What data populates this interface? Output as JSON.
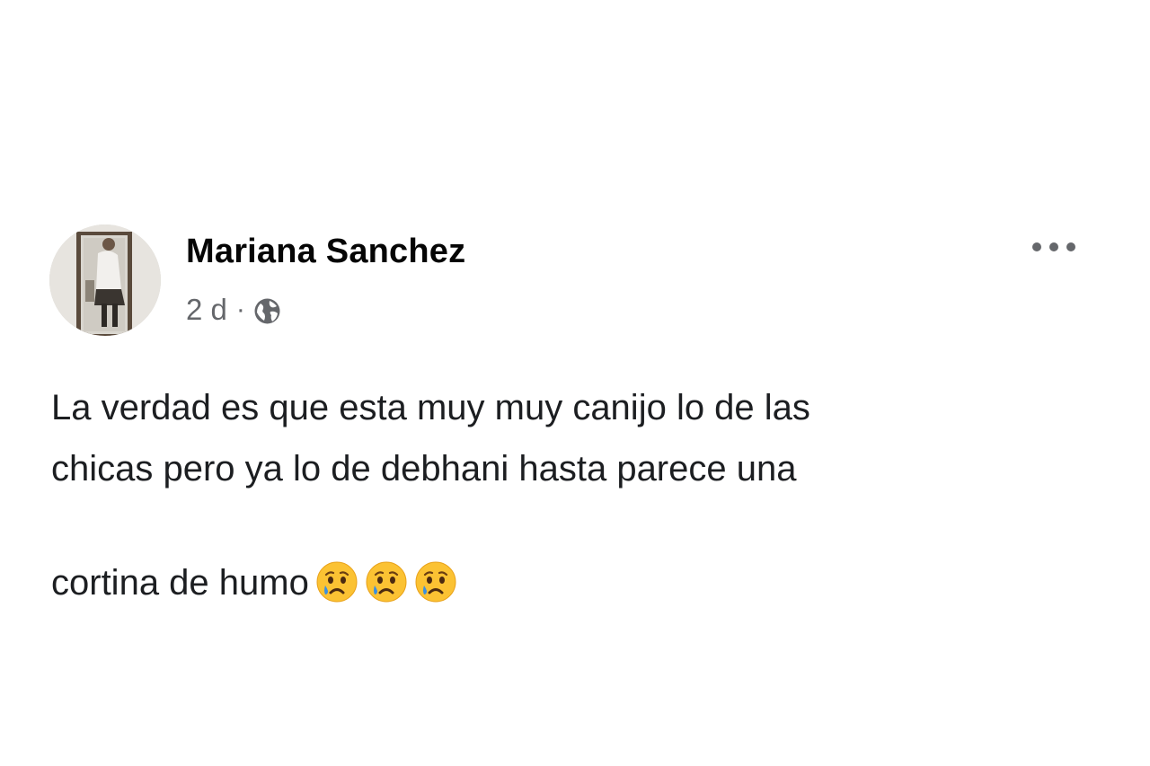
{
  "post": {
    "author": "Mariana Sanchez",
    "timestamp": "2 d",
    "separator": "·",
    "audience_icon": "globe-icon",
    "menu_icon": "more-options-icon",
    "body_text": "La verdad es que esta muy muy canijo lo de las\nchicas pero ya lo de debhani hasta parece una\ncortina de humo",
    "emojis": [
      "crying-face-emoji",
      "crying-face-emoji",
      "crying-face-emoji"
    ]
  },
  "colors": {
    "name": "#050505",
    "meta": "#65676b",
    "text": "#1c1e21",
    "background": "#ffffff"
  }
}
